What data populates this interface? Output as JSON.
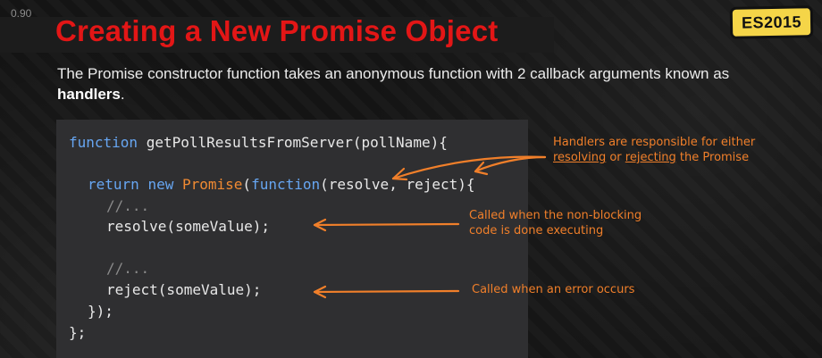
{
  "slide": {
    "version": "0.90",
    "title": "Creating a New Promise Object",
    "badge": "ES2015",
    "subtitle_before": "The Promise constructor function takes an anonymous function with 2 callback arguments known as ",
    "subtitle_bold": "handlers",
    "subtitle_after": "."
  },
  "code": {
    "line1_kw": "function",
    "line1_rest": " getPollResultsFromServer(pollName){",
    "line2_kw1": "return",
    "line2_kw2": "new",
    "line2_ctor": "Promise",
    "line2_kw3": "function",
    "line2_rest": "(resolve, reject){",
    "comment1": "//...",
    "resolve_call": "resolve(someValue);",
    "comment2": "//...",
    "reject_call": "reject(someValue);",
    "close_inner": "});",
    "close_outer": "};"
  },
  "annotations": {
    "handlers_line1": "Handlers are responsible for either",
    "handlers_resolving": "resolving",
    "handlers_or": " or ",
    "handlers_rejecting": "rejecting",
    "handlers_end": " the Promise",
    "resolve_line1": "Called when the non-blocking",
    "resolve_line2": "code is done executing",
    "reject_note": "Called when an error occurs"
  },
  "colors": {
    "title": "#e31616",
    "keyword": "#67a6f2",
    "constructor": "#f08a32",
    "annotation": "#f07f2a",
    "badge": "#f5d548"
  }
}
